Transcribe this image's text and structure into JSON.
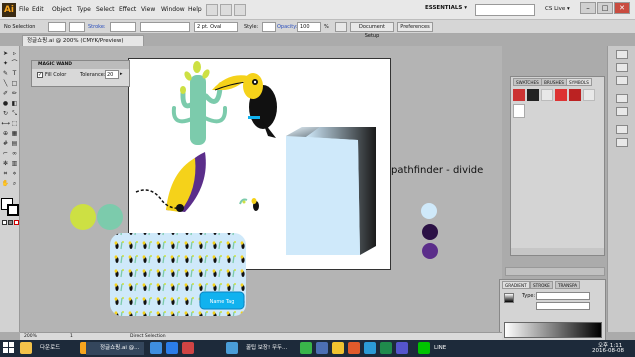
{
  "app": {
    "logo": "Ai"
  },
  "menu": [
    "File",
    "Edit",
    "Object",
    "Type",
    "Select",
    "Effect",
    "View",
    "Window",
    "Help"
  ],
  "workspace": "ESSENTIALS ▾",
  "cs_live": "CS Live ▾",
  "window_controls": {
    "minimize": "–",
    "maximize": "□",
    "close": "✕"
  },
  "control_bar": {
    "selection": "No Selection",
    "stroke_label": "Stroke:",
    "brush": "2 pt. Oval",
    "style_label": "Style:",
    "opacity_label": "Opacity:",
    "opacity_value": "100",
    "opacity_unit": "%",
    "document_setup": "Document Setup",
    "preferences": "Preferences"
  },
  "document_tab": "정글쇼핑.ai @ 200% (CMYK/Preview)",
  "magic_wand": {
    "title": "MAGIC WAND",
    "fill_color": "Fill Color",
    "tolerance_label": "Tolerance:",
    "tolerance_value": "20"
  },
  "swatches_panel": {
    "tabs": [
      "SWATCHES",
      "BRUSHES",
      "SYMBOLS"
    ]
  },
  "gradient_panel": {
    "tabs": [
      "GRADIENT",
      "STROKE",
      "TRANSPA"
    ],
    "type_label": "Type:"
  },
  "canvas_text": {
    "pathfinder": "pathfinder - divide",
    "name_tag": "Name Tag"
  },
  "status": {
    "zoom": "200%",
    "page": "1",
    "tool": "Direct Selection"
  },
  "taskbar": {
    "items": [
      "다운로드",
      "정글쇼핑.ai @...",
      "꿀팁 보장! 무두...",
      "LINE"
    ],
    "time": "오후 1:11",
    "date": "2016-08-08"
  },
  "colors": {
    "toucan_black": "#111111",
    "beak_yellow": "#f5d21a",
    "cactus_green": "#7ccbac",
    "lime": "#cde043",
    "purple": "#5b2e8a",
    "dark_purple": "#2b1145",
    "light_blue": "#cfe9fa",
    "tag_blue": "#10b2ef"
  }
}
